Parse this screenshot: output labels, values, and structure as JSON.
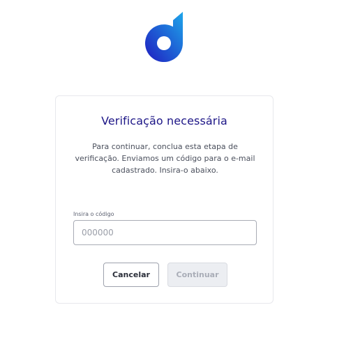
{
  "brand": {
    "logo_icon": "d-logo-icon",
    "colors": {
      "gradient_start": "#1f1cc0",
      "gradient_end": "#1ea6ea"
    }
  },
  "card": {
    "title": "Verificação necessária",
    "description": "Para continuar, conclua esta etapa de verificação. Enviamos um código para o e-mail cadastrado. Insira-o abaixo.",
    "field_label": "Insira o código",
    "input": {
      "value": "",
      "placeholder": "000000"
    },
    "buttons": {
      "cancel_label": "Cancelar",
      "continue_label": "Continuar",
      "continue_disabled": true
    }
  },
  "colors": {
    "title": "#1d1687",
    "disabled_button_bg": "#eceef2"
  }
}
